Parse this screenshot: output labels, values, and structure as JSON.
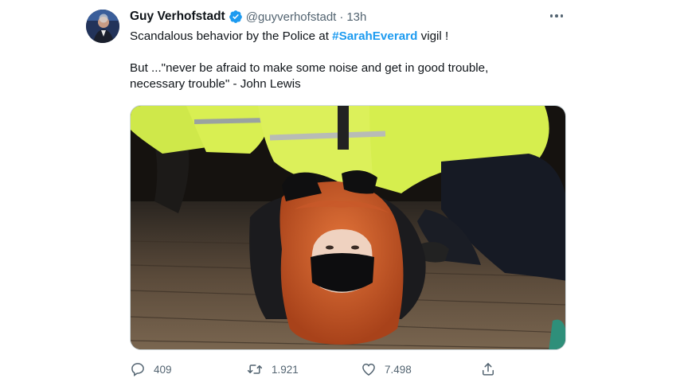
{
  "tweet": {
    "author_name": "Guy Verhofstadt",
    "handle": "@guyverhofstadt",
    "separator": "·",
    "time": "13h",
    "text": {
      "line1_before": "Scandalous behavior by the Police at ",
      "line1_hashtag": "#SarahEverard",
      "line1_after": " vigil !",
      "line2": "But ...\"never be afraid to make some noise and get in good trouble,",
      "line3": "necessary trouble\" - John Lewis"
    }
  },
  "actions": {
    "reply_count": "409",
    "retweet_count": "1.921",
    "like_count": "7.498"
  },
  "icons": {
    "verified": "verified-badge-icon",
    "more": "more-options-icon",
    "reply": "reply-icon",
    "retweet": "retweet-icon",
    "like": "heart-icon",
    "share": "share-icon"
  },
  "colors": {
    "accent": "#1d9bf0",
    "secondary_text": "#536471",
    "primary_text": "#0f1419"
  }
}
